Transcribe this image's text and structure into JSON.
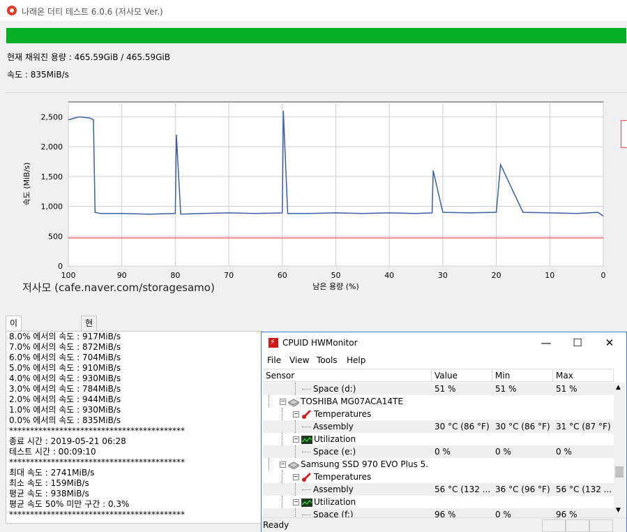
{
  "window": {
    "title": "나래온 더티 테스트 6.0.6 (저사모 Ver.)"
  },
  "progress": {
    "fraction": 1.0,
    "color": "#06b025"
  },
  "info": {
    "capacity": "현재 채워진 용량 : 465.59GiB / 465.59GiB",
    "speed": "속도 : 835MiB/s"
  },
  "watermark": "저사모 (cafe.naver.com/storagesamo)",
  "chart_data": {
    "type": "line",
    "ylabel": "속도 (MiB/s)",
    "xlabel": "남은 용량 (%)",
    "xlim": [
      100,
      0
    ],
    "ylim": [
      0,
      2750
    ],
    "yticks": [
      "0",
      "500",
      "1,000",
      "1,500",
      "2,000",
      "2,500"
    ],
    "ytick_values": [
      0,
      500,
      1000,
      1500,
      2000,
      2500
    ],
    "xticks": [
      "100",
      "90",
      "80",
      "70",
      "60",
      "50",
      "40",
      "30",
      "20",
      "10",
      "0"
    ],
    "xtick_values": [
      100,
      90,
      80,
      70,
      60,
      50,
      40,
      30,
      20,
      10,
      0
    ],
    "threshold": 470,
    "threshold_color": "#ff2020",
    "line_color": "#3a5fa6",
    "grid": true,
    "series": [
      {
        "x": [
          100,
          98,
          96,
          95.3,
          95,
          94,
          90,
          85,
          80,
          79.8,
          79,
          75,
          70,
          65,
          60,
          59.8,
          59,
          55,
          50,
          45,
          40,
          35,
          32,
          31.8,
          30,
          25,
          20,
          19.2,
          15,
          10,
          5,
          1,
          0
        ],
        "y": [
          2450,
          2500,
          2480,
          2450,
          900,
          880,
          880,
          870,
          880,
          2200,
          870,
          880,
          890,
          880,
          890,
          2600,
          880,
          880,
          890,
          880,
          890,
          880,
          890,
          1600,
          900,
          890,
          900,
          1700,
          900,
          890,
          880,
          900,
          835
        ]
      }
    ]
  },
  "tabs": [
    {
      "label": "이전 + 현재 회차"
    },
    {
      "label": "현재 회차"
    }
  ],
  "log_lines": [
    "8.0% 에서의 속도 : 917MiB/s",
    "7.0% 에서의 속도 : 872MiB/s",
    "6.0% 에서의 속도 : 704MiB/s",
    "5.0% 에서의 속도 : 910MiB/s",
    "4.0% 에서의 속도 : 930MiB/s",
    "3.0% 에서의 속도 : 784MiB/s",
    "2.0% 에서의 속도 : 944MiB/s",
    "1.0% 에서의 속도 : 930MiB/s",
    "0.0% 에서의 속도 : 835MiB/s",
    "******************************************",
    "종료 시간 : 2019-05-21 06:28",
    "테스트 시간 : 00:09:10",
    "******************************************",
    "최대 속도 : 2741MiB/s",
    "최소 속도 : 159MiB/s",
    "평균 속도 : 938MiB/s",
    "평균 속도 50% 미만 구간 : 0.3%",
    "******************************************"
  ],
  "hwmonitor": {
    "title": "CPUID HWMonitor",
    "controls": {
      "minimize": "—",
      "maximize": "☐",
      "close": "✕"
    },
    "menu": [
      "File",
      "View",
      "Tools",
      "Help"
    ],
    "columns": [
      "Sensor",
      "Value",
      "Min",
      "Max"
    ],
    "rows": [
      {
        "level": 3,
        "icon": "",
        "name": "Space (d:)",
        "value": "51 %",
        "min": "51 %",
        "max": "51 %",
        "shade": true
      },
      {
        "level": 1,
        "icon": "drive",
        "name": "TOSHIBA MG07ACA14TE",
        "value": "",
        "min": "",
        "max": "",
        "shade": false
      },
      {
        "level": 2,
        "icon": "thermometer",
        "name": "Temperatures",
        "value": "",
        "min": "",
        "max": "",
        "shade": false
      },
      {
        "level": 3,
        "icon": "",
        "name": "Assembly",
        "value": "30 °C  (86 °F)",
        "min": "30 °C  (86 °F)",
        "max": "31 °C  (87 °F)",
        "shade": true
      },
      {
        "level": 2,
        "icon": "utilization",
        "name": "Utilization",
        "value": "",
        "min": "",
        "max": "",
        "shade": false
      },
      {
        "level": 3,
        "icon": "",
        "name": "Space (e:)",
        "value": "0 %",
        "min": "0 %",
        "max": "0 %",
        "shade": true
      },
      {
        "level": 1,
        "icon": "drive",
        "name": "Samsung SSD 970 EVO Plus 5...",
        "value": "",
        "min": "",
        "max": "",
        "shade": false
      },
      {
        "level": 2,
        "icon": "thermometer",
        "name": "Temperatures",
        "value": "",
        "min": "",
        "max": "",
        "shade": false
      },
      {
        "level": 3,
        "icon": "",
        "name": "Assembly",
        "value": "56 °C  (132 ...",
        "min": "36 °C  (96 °F)",
        "max": "56 °C  (132 ...",
        "shade": true
      },
      {
        "level": 2,
        "icon": "utilization",
        "name": "Utilization",
        "value": "",
        "min": "",
        "max": "",
        "shade": false
      },
      {
        "level": 3,
        "icon": "",
        "name": "Space (f:)",
        "value": "96 %",
        "min": "0 %",
        "max": "96 %",
        "shade": true
      }
    ],
    "status": "Ready"
  }
}
